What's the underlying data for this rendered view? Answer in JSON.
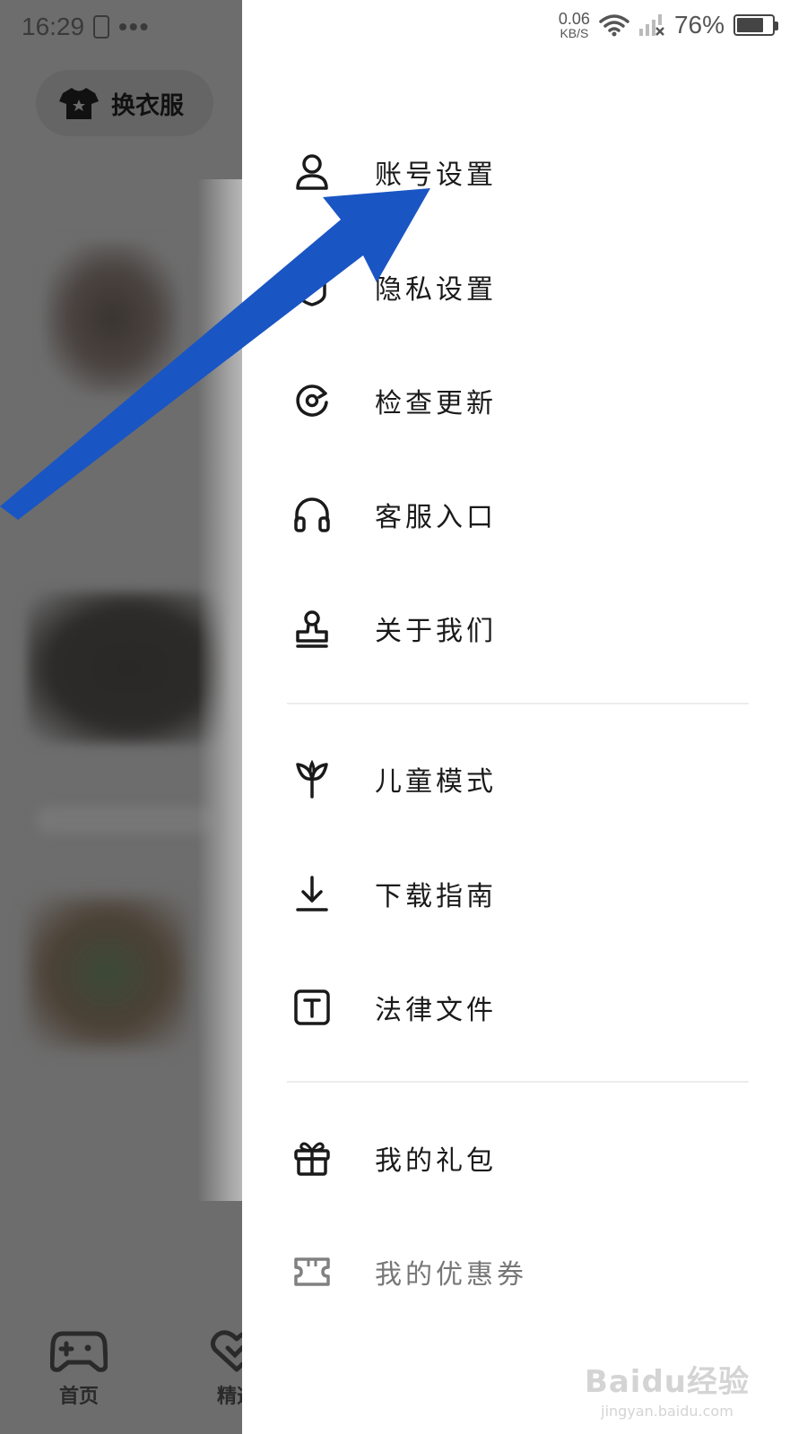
{
  "background_app": {
    "status_time": "16:29",
    "status_dots": "•••",
    "outfit_button_label": "换衣服",
    "tabs": [
      {
        "label": "首页",
        "icon": "gamepad-icon"
      },
      {
        "label": "精选",
        "icon": "heart-icon"
      }
    ]
  },
  "status_bar": {
    "net_speed_value": "0.06",
    "net_speed_unit": "KB/S",
    "battery_percent": "76%",
    "battery_level": 0.76
  },
  "menu": {
    "group1": [
      {
        "label": "账号设置",
        "icon": "user-icon"
      },
      {
        "label": "隐私设置",
        "icon": "privacy-icon"
      },
      {
        "label": "检查更新",
        "icon": "refresh-icon"
      },
      {
        "label": "客服入口",
        "icon": "headphones-icon"
      },
      {
        "label": "关于我们",
        "icon": "about-stamp-icon"
      }
    ],
    "group2": [
      {
        "label": "儿童模式",
        "icon": "sprout-icon"
      },
      {
        "label": "下载指南",
        "icon": "download-icon"
      },
      {
        "label": "法律文件",
        "icon": "text-box-icon"
      }
    ],
    "group3": [
      {
        "label": "我的礼包",
        "icon": "gift-icon"
      },
      {
        "label": "我的优惠券",
        "icon": "coupon-icon"
      }
    ]
  },
  "annotation_arrow_color": "#1a55c4",
  "watermark": {
    "main": "Baidu经验",
    "sub": "jingyan.baidu.com"
  }
}
